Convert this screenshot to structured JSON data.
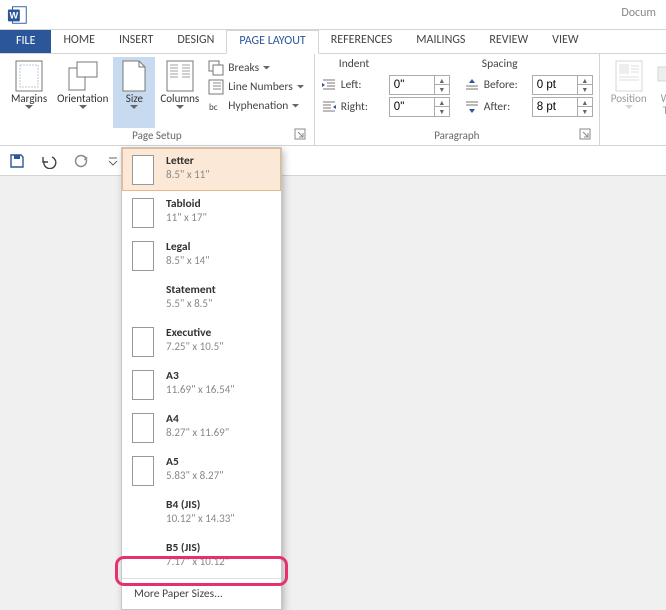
{
  "title_partial": "Docum",
  "tabs": {
    "file": "FILE",
    "items": [
      "HOME",
      "INSERT",
      "DESIGN",
      "PAGE LAYOUT",
      "REFERENCES",
      "MAILINGS",
      "REVIEW",
      "VIEW"
    ],
    "active_index": 3
  },
  "ribbon": {
    "page_setup": {
      "label": "Page Setup",
      "margins": "Margins",
      "orientation": "Orientation",
      "size": "Size",
      "columns": "Columns",
      "breaks": "Breaks",
      "line_numbers": "Line Numbers",
      "hyphenation": "Hyphenation"
    },
    "paragraph": {
      "label": "Paragraph",
      "indent": "Indent",
      "spacing": "Spacing",
      "left_label": "Left:",
      "right_label": "Right:",
      "before_label": "Before:",
      "after_label": "After:",
      "left_value": "0\"",
      "right_value": "0\"",
      "before_value": "0 pt",
      "after_value": "8 pt"
    },
    "arrange": {
      "position": "Position",
      "wrap_partial": "W\nT"
    }
  },
  "size_gallery": {
    "items": [
      {
        "name": "Letter",
        "dims": "8.5\" x 11\"",
        "selected": true,
        "icon": true
      },
      {
        "name": "Tabloid",
        "dims": "11\" x 17\"",
        "icon": true
      },
      {
        "name": "Legal",
        "dims": "8.5\" x 14\"",
        "icon": true
      },
      {
        "name": "Statement",
        "dims": "5.5\" x 8.5\"",
        "icon": false
      },
      {
        "name": "Executive",
        "dims": "7.25\" x 10.5\"",
        "icon": true
      },
      {
        "name": "A3",
        "dims": "11.69\" x 16.54\"",
        "icon": true
      },
      {
        "name": "A4",
        "dims": "8.27\" x 11.69\"",
        "icon": true
      },
      {
        "name": "A5",
        "dims": "5.83\" x 8.27\"",
        "icon": true
      },
      {
        "name": "B4 (JIS)",
        "dims": "10.12\" x 14.33\"",
        "icon": false
      },
      {
        "name": "B5 (JIS)",
        "dims": "7.17\" x 10.12\"",
        "icon": false
      }
    ],
    "footer": "More Paper Sizes..."
  }
}
